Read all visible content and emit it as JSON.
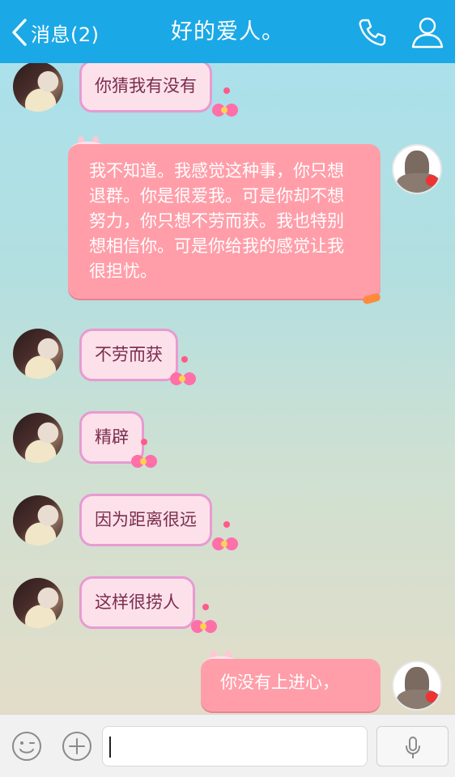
{
  "header": {
    "back_label": "消息(2)",
    "title": "好的爱人。",
    "icons": [
      "chevron-left-icon",
      "phone-icon",
      "profile-icon"
    ]
  },
  "messages": [
    {
      "side": "left",
      "text": "你猜我有没有"
    },
    {
      "side": "right",
      "text": "我不知道。我感觉这种事，你只想退群。你是很爱我。可是你却不想努力，你只想不劳而获。我也特别想相信你。可是你给我的感觉让我很担忧。"
    },
    {
      "side": "left",
      "text": "不劳而获"
    },
    {
      "side": "left",
      "text": "精辟"
    },
    {
      "side": "left",
      "text": "因为距离很远"
    },
    {
      "side": "left",
      "text": "这样很捞人"
    },
    {
      "side": "right",
      "text": "你没有上进心，"
    }
  ],
  "input": {
    "value": "",
    "placeholder": ""
  },
  "colors": {
    "header_bg": "#1ba8e6",
    "left_bubble_bg": "#fde1ea",
    "left_bubble_border": "#e79bd1",
    "right_bubble_bg": "#ff9ea9"
  }
}
